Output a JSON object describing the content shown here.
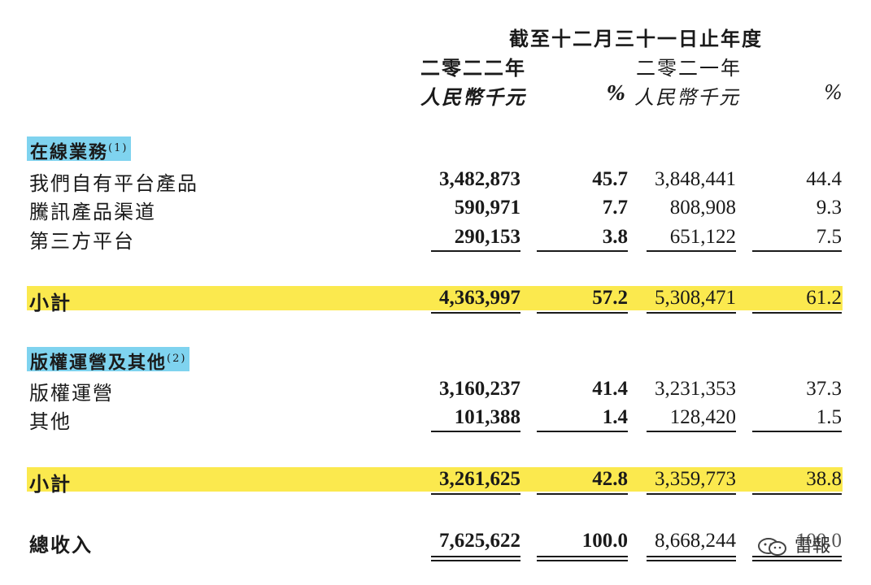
{
  "header": {
    "period": "截至十二月三十一日止年度",
    "year_2022": "二零二二年",
    "year_2021": "二零二一年",
    "unit_2022": "人民幣千元",
    "pct_2022": "%",
    "unit_2021": "人民幣千元",
    "pct_2021": "%"
  },
  "online": {
    "title": "在線業務",
    "note": "(1)",
    "rows": [
      {
        "label": "我們自有平台產品",
        "v2022": "3,482,873",
        "p2022": "45.7",
        "v2021": "3,848,441",
        "p2021": "44.4"
      },
      {
        "label": "騰訊產品渠道",
        "v2022": "590,971",
        "p2022": "7.7",
        "v2021": "808,908",
        "p2021": "9.3"
      },
      {
        "label": "第三方平台",
        "v2022": "290,153",
        "p2022": "3.8",
        "v2021": "651,122",
        "p2021": "7.5"
      }
    ],
    "subtotal": {
      "label": "小計",
      "v2022": "4,363,997",
      "p2022": "57.2",
      "v2021": "5,308,471",
      "p2021": "61.2"
    }
  },
  "copyright": {
    "title": "版權運營及其他",
    "note": "(2)",
    "rows": [
      {
        "label": "版權運營",
        "v2022": "3,160,237",
        "p2022": "41.4",
        "v2021": "3,231,353",
        "p2021": "37.3"
      },
      {
        "label": "其他",
        "v2022": "101,388",
        "p2022": "1.4",
        "v2021": "128,420",
        "p2021": "1.5"
      }
    ],
    "subtotal": {
      "label": "小計",
      "v2022": "3,261,625",
      "p2022": "42.8",
      "v2021": "3,359,773",
      "p2021": "38.8"
    }
  },
  "total": {
    "label": "總收入",
    "v2022": "7,625,622",
    "p2022": "100.0",
    "v2021": "8,668,244",
    "p2021": "100.0"
  },
  "watermark": "雷報"
}
